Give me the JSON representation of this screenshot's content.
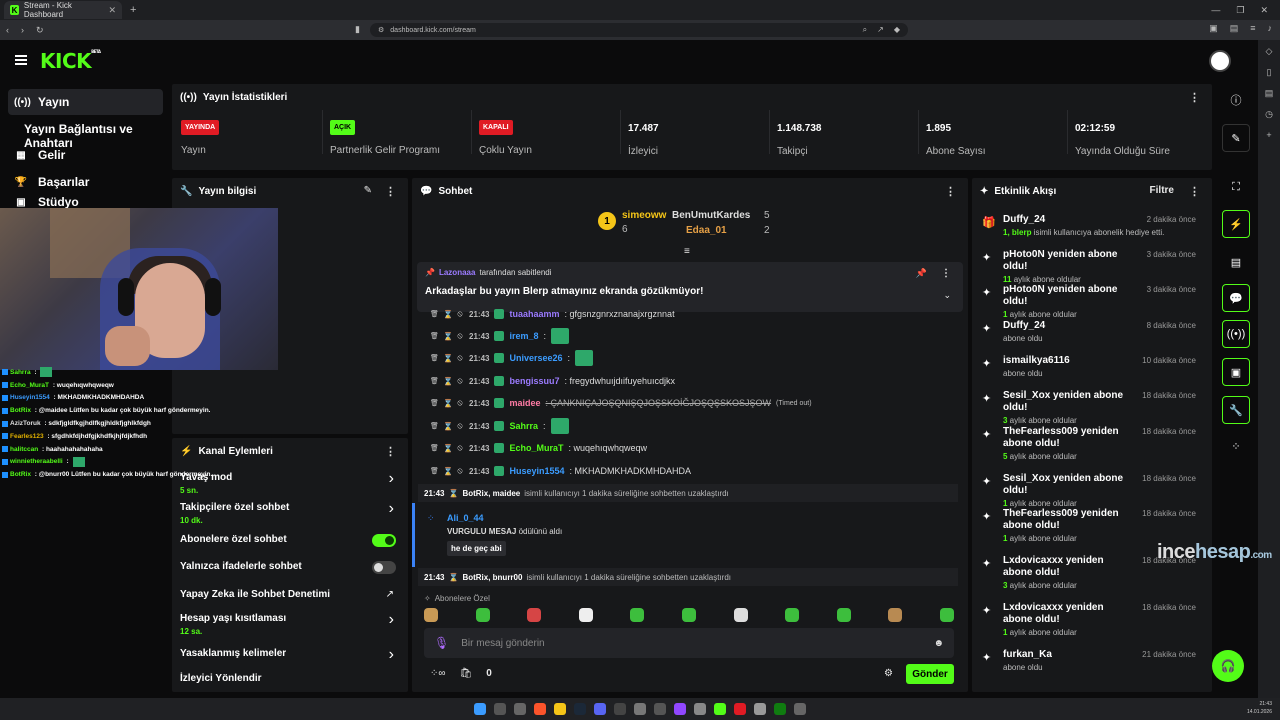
{
  "browser": {
    "tab_title": "Stream - Kick Dashboard",
    "url": "dashboard.kick.com/stream"
  },
  "brand": {
    "logo": "KICK",
    "logo_sup": "BETA",
    "accent": "#53fc18"
  },
  "nav": {
    "yayin": "Yayın",
    "baglanti": "Yayın Bağlantısı ve Anahtarı",
    "gelir": "Gelir",
    "basarilar": "Başarılar",
    "studyo": "Stüdyo"
  },
  "stats": {
    "title": "Yayın İstatistikleri",
    "items": [
      {
        "value": "YAYINDA",
        "label": "Yayın",
        "pill_color": "#e01b24",
        "text_color": "#ffffff"
      },
      {
        "value": "AÇIK",
        "label": "Partnerlik Gelir Programı",
        "pill_color": "#53fc18",
        "text_color": "#000000"
      },
      {
        "value": "KAPALI",
        "label": "Çoklu Yayın",
        "pill_color": "#e01b24",
        "text_color": "#ffffff"
      },
      {
        "value": "17.487",
        "label": "İzleyici"
      },
      {
        "value": "1.148.738",
        "label": "Takipçi"
      },
      {
        "value": "1.895",
        "label": "Abone Sayısı"
      },
      {
        "value": "02:12:59",
        "label": "Yayında Olduğu Süre"
      }
    ]
  },
  "yayin_bilgi": {
    "title": "Yayın bilgisi"
  },
  "overlay_chat": [
    {
      "user": "Sahrra",
      "color": "#53fc18",
      "text": " : ",
      "emote": true
    },
    {
      "user": "Echo_MuraT",
      "color": "#53fc18",
      "text": " : wuqehıqwhqweqw"
    },
    {
      "user": "Huseyin1554",
      "color": "#3b9cff",
      "text": " : MKHADMKHADKMHDAHDA"
    },
    {
      "user": "BotRix",
      "color": "#53fc18",
      "text": " : @maidee Lütfen bu kadar çok büyük harf göndermeyin."
    },
    {
      "user": "AzizToruk",
      "color": "#e0e0e0",
      "text": " : sdkfjgldfkgjhdlfkgjhldkfjghlkfdgh"
    },
    {
      "user": "Fearles123",
      "color": "#e0b000",
      "text": " : sfgdhkfdjhdfgjkhdfkjhjfdjkfhdh"
    },
    {
      "user": "halitccan",
      "color": "#53fc18",
      "text": " : haahahahahahaha"
    },
    {
      "user": "winnietheraabelli",
      "color": "#53fc18",
      "text": " : ",
      "emote": true
    },
    {
      "user": "BotRix",
      "color": "#53fc18",
      "text": " : @bnurr00 Lütfen bu kadar çok büyük harf göndermeyin."
    }
  ],
  "kanal": {
    "title": "Kanal Eylemleri",
    "items": [
      {
        "label": "Yavaş mod",
        "sub": "5 sn.",
        "control": "chevron"
      },
      {
        "label": "Takipçilere özel sohbet",
        "sub": "10 dk.",
        "control": "chevron"
      },
      {
        "label": "Abonelere özel sohbet",
        "sub": "",
        "control": "toggle-on"
      },
      {
        "label": "Yalnızca ifadelerle sohbet",
        "sub": "",
        "control": "toggle-off"
      },
      {
        "label": "Yapay Zeka ile Sohbet Denetimi",
        "sub": "",
        "control": "external"
      },
      {
        "label": "Hesap yaşı kısıtlaması",
        "sub": "12 sa.",
        "control": "chevron"
      },
      {
        "label": "Yasaklanmış kelimeler",
        "sub": "",
        "control": "chevron"
      },
      {
        "label": "İzleyici Yönlendir",
        "sub": "",
        "control": "none"
      }
    ]
  },
  "chat": {
    "title": "Sohbet",
    "top_gifter": {
      "user": "simeoww",
      "count": "6"
    },
    "second": {
      "user": "BenUmutKardes",
      "count": "5"
    },
    "third": {
      "user": "Edaa_01",
      "count": "2"
    },
    "pinned": {
      "by_user": "Lazonaaa",
      "by_text": "tarafından sabitlendi",
      "message": "Arkadaşlar bu yayın Blerp atmayınız ekranda gözükmüyor!"
    },
    "messages": [
      {
        "time": "21:43",
        "user": "tuaahaamm",
        "color": "#9b7bff",
        "text": ": gfgsnzgnrxznanajxrgznnat",
        "emote": false
      },
      {
        "time": "21:43",
        "user": "irem_8",
        "color": "#3b9cff",
        "text": ":",
        "emote": true
      },
      {
        "time": "21:43",
        "user": "Universee26",
        "color": "#3b9cff",
        "text": ":",
        "emote": true
      },
      {
        "time": "21:43",
        "user": "bengissuu7",
        "color": "#9b7bff",
        "text": ": fregydwhuıjdıifuyehuıcdjkx",
        "emote": false
      },
      {
        "time": "21:43",
        "user": "maidee",
        "color": "#ff7ba5",
        "text": ": ÇANKNIÇAJOŞQNIŞQJOŞSKOİĞJOŞQŞSKOSJŞOW",
        "suffix": "(Timed out)",
        "struck": true
      },
      {
        "time": "21:43",
        "user": "Sahrra",
        "color": "#53fc18",
        "text": ":",
        "emote": true
      },
      {
        "time": "21:43",
        "user": "Echo_MuraT",
        "color": "#53fc18",
        "text": ": wuqehıqwhqweqw",
        "emote": false
      },
      {
        "time": "21:43",
        "user": "Huseyin1554",
        "color": "#3b9cff",
        "text": ": MKHADMKHADKMHDAHDA",
        "emote": false
      }
    ],
    "sys1": {
      "time": "21:43",
      "names": "BotRix, maidee",
      "text": "isimli kullanıcıyı 1 dakika süreliğine sohbetten uzaklaştırdı"
    },
    "reward": {
      "user": "Ali_0_44",
      "title": "VURGULU MESAJ",
      "title_suffix": "ödülünü aldı",
      "message": "he de geç abi"
    },
    "sys2": {
      "time": "21:43",
      "names": "BotRix, bnurr00",
      "text": "isimli kullanıcıyı 1 dakika süreliğine sohbetten uzaklaştırdı"
    },
    "subs_label": "Abonelere Özel",
    "placeholder": "Bir mesaj gönderin",
    "send": "Gönder",
    "points": "0"
  },
  "activity": {
    "title": "Etkinlik Akışı",
    "filter": "Filtre",
    "items": [
      {
        "title": "Duffy_24",
        "desc_bold": "1, blerp",
        "desc": " isimli kullanıcıya abonelik hediye etti.",
        "time": "2 dakika önce",
        "icon": "gift"
      },
      {
        "title": "pHoto0N yeniden abone oldu!",
        "desc_bold": "11",
        "desc": " aylık abone oldular",
        "time": "3 dakika önce",
        "icon": "star"
      },
      {
        "title": "pHoto0N yeniden abone oldu!",
        "desc_bold": "1",
        "desc": " aylık abone oldular",
        "time": "3 dakika önce",
        "icon": "star"
      },
      {
        "title": "Duffy_24",
        "desc_bold": "",
        "desc": "abone oldu",
        "time": "8 dakika önce",
        "icon": "star"
      },
      {
        "title": "ismailkya6116",
        "desc_bold": "",
        "desc": "abone oldu",
        "time": "10 dakika önce",
        "icon": "star"
      },
      {
        "title": "Sesil_Xox yeniden abone oldu!",
        "desc_bold": "3",
        "desc": " aylık abone oldular",
        "time": "18 dakika önce",
        "icon": "star"
      },
      {
        "title": "TheFearless009 yeniden abone oldu!",
        "desc_bold": "5",
        "desc": " aylık abone oldular",
        "time": "18 dakika önce",
        "icon": "star"
      },
      {
        "title": "Sesil_Xox yeniden abone oldu!",
        "desc_bold": "1",
        "desc": " aylık abone oldular",
        "time": "18 dakika önce",
        "icon": "star"
      },
      {
        "title": "TheFearless009 yeniden abone oldu!",
        "desc_bold": "1",
        "desc": " aylık abone oldular",
        "time": "18 dakika önce",
        "icon": "star"
      },
      {
        "title": "Lxdovicaxxx yeniden abone oldu!",
        "desc_bold": "3",
        "desc": " aylık abone oldular",
        "time": "18 dakika önce",
        "icon": "star"
      },
      {
        "title": "Lxdovicaxxx yeniden abone oldu!",
        "desc_bold": "1",
        "desc": " aylık abone oldular",
        "time": "18 dakika önce",
        "icon": "star"
      },
      {
        "title": "furkan_Ka",
        "desc_bold": "",
        "desc": "abone oldu",
        "time": "21 dakika önce",
        "icon": "star"
      }
    ]
  },
  "watermark": {
    "a": "ince",
    "b": "hesap",
    "c": ".com"
  },
  "clock": {
    "time": "21:43",
    "date": "14.01.2026"
  }
}
